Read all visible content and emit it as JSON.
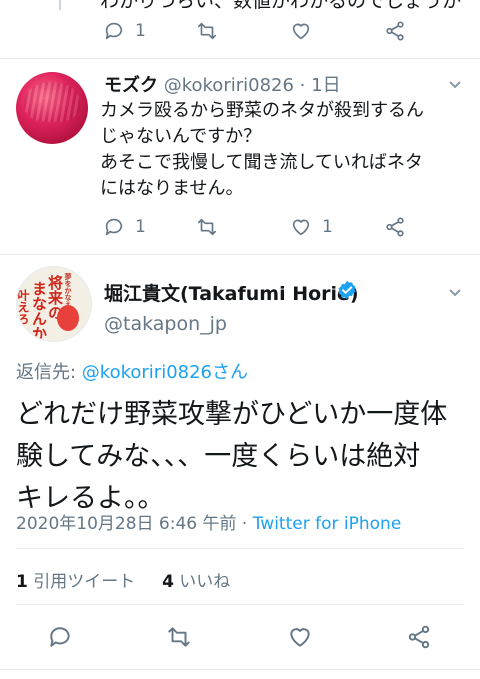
{
  "prev_tweet": {
    "clipped_text": "わかりづらい、数値がわかるのでしょうか",
    "reply_count": "1"
  },
  "reply_tweet": {
    "name": "モズク",
    "handle": "@kokoriri0826",
    "sep": "·",
    "time": "1日",
    "lines": [
      "カメラ殴るから野菜のネタが殺到するん",
      "じゃないんですか？",
      "あそこで我慢して聞き流していればネタ",
      "にはなりません。"
    ],
    "reply_count": "1",
    "like_count": "1"
  },
  "main_tweet": {
    "name": "堀江貴文(Takafumi Horie)",
    "handle": "@takapon_jp",
    "reply_prefix": "返信先: ",
    "reply_target": "@kokoriri0826さん",
    "lines": [
      "どれだけ野菜攻撃がひどいか一度体",
      "験してみな、、、一度くらいは絶対",
      "キレるよ。。"
    ],
    "datetime": "2020年10月28日 6:46 午前",
    "meta_sep": " · ",
    "source": "Twitter for iPhone",
    "retweet_count": "1",
    "retweet_label": " 引用ツイート",
    "like_count": "4",
    "like_label": " いいね",
    "avatar_text": {
      "a": "夢をかなえる",
      "b": "将来の",
      "c": "まなんか",
      "d": "叶えろ"
    }
  },
  "colors": {
    "accent": "#1da1f2",
    "secondary_text": "#657786",
    "divider": "#e6ecf0"
  }
}
